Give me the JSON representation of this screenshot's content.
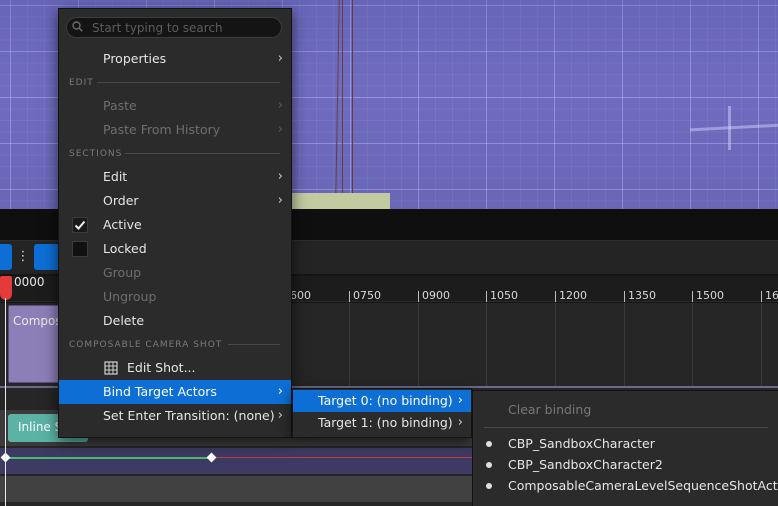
{
  "menu": {
    "search_placeholder": "Start typing to search",
    "properties_label": "Properties",
    "section_edit": "EDIT",
    "paste_label": "Paste",
    "paste_history_label": "Paste From History",
    "section_sections": "SECTIONS",
    "edit_label": "Edit",
    "order_label": "Order",
    "active_label": "Active",
    "active_checked": true,
    "locked_label": "Locked",
    "locked_checked": false,
    "group_label": "Group",
    "ungroup_label": "Ungroup",
    "delete_label": "Delete",
    "section_camera_shot": "COMPOSABLE CAMERA SHOT",
    "edit_shot_label": "Edit Shot...",
    "bind_target_label": "Bind Target Actors",
    "enter_transition_label": "Set Enter Transition: (none)"
  },
  "submenu_targets": {
    "target0_label": "Target 0: (no binding)",
    "target1_label": "Target 1: (no binding)"
  },
  "submenu_actors": {
    "clear_label": "Clear binding",
    "actor1": "CBP_SandboxCharacter",
    "actor2": "CBP_SandboxCharacter2",
    "actor3": "ComposableCameraLevelSequenceShotActor"
  },
  "sequencer": {
    "current_time": "0000",
    "ticks": [
      "600",
      "0750",
      "0900",
      "1050",
      "1200",
      "1350",
      "1500",
      "16"
    ],
    "shot_clip_label": "Compos",
    "inline_clip_label": "Inline S"
  },
  "colors": {
    "accent": "#0d6fd6",
    "menu_bg": "#2b2b2b",
    "playhead": "#e33a3a",
    "viewport_floor": "#6f6cc0"
  }
}
